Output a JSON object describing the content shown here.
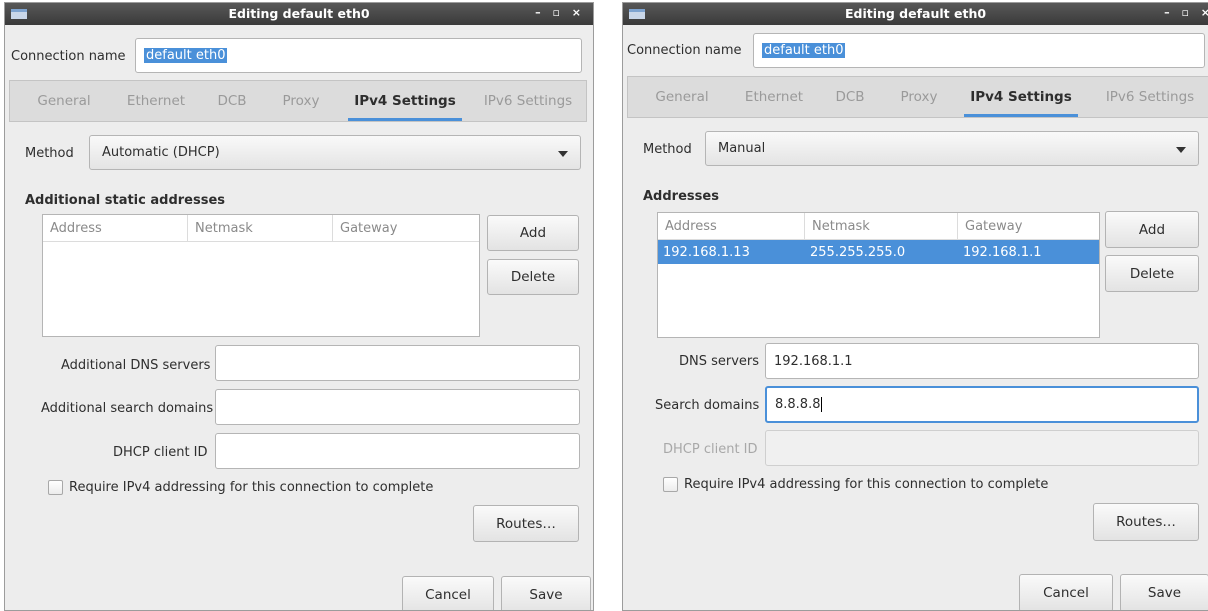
{
  "colors": {
    "accent": "#4a90d9",
    "titlebar": "#3a3a3a",
    "window_bg": "#ededed"
  },
  "windows": [
    {
      "title": "Editing default eth0",
      "controls": "– ▫ ×",
      "connection_name_label": "Connection name",
      "connection_name_value": "default eth0",
      "tabs": [
        "General",
        "Ethernet",
        "DCB",
        "Proxy",
        "IPv4 Settings",
        "IPv6 Settings"
      ],
      "active_tab": "IPv4 Settings",
      "method_label": "Method",
      "method_value": "Automatic (DHCP)",
      "addresses_title": "Additional static addresses",
      "columns": [
        "Address",
        "Netmask",
        "Gateway"
      ],
      "add_label": "Add",
      "delete_label": "Delete",
      "dns_label": "Additional DNS servers",
      "dns_value": "",
      "search_label": "Additional search domains",
      "search_value": "",
      "dhcp_label": "DHCP client ID",
      "dhcp_value": "",
      "require_label": "Require IPv4 addressing for this connection to complete",
      "require_checked": false,
      "routes_label": "Routes…",
      "cancel_label": "Cancel",
      "save_label": "Save"
    },
    {
      "title": "Editing default eth0",
      "controls": "– ▫ ×",
      "connection_name_label": "Connection name",
      "connection_name_value": "default eth0",
      "tabs": [
        "General",
        "Ethernet",
        "DCB",
        "Proxy",
        "IPv4 Settings",
        "IPv6 Settings"
      ],
      "active_tab": "IPv4 Settings",
      "method_label": "Method",
      "method_value": "Manual",
      "addresses_title": "Addresses",
      "columns": [
        "Address",
        "Netmask",
        "Gateway"
      ],
      "rows": [
        {
          "address": "192.168.1.13",
          "netmask": "255.255.255.0",
          "gateway": "192.168.1.1"
        }
      ],
      "add_label": "Add",
      "delete_label": "Delete",
      "dns_label": "DNS servers",
      "dns_value": "192.168.1.1",
      "search_label": "Search domains",
      "search_value": "8.8.8.8",
      "dhcp_label": "DHCP client ID",
      "dhcp_value": "",
      "require_label": "Require IPv4 addressing for this connection to complete",
      "require_checked": false,
      "routes_label": "Routes…",
      "cancel_label": "Cancel",
      "save_label": "Save"
    }
  ]
}
